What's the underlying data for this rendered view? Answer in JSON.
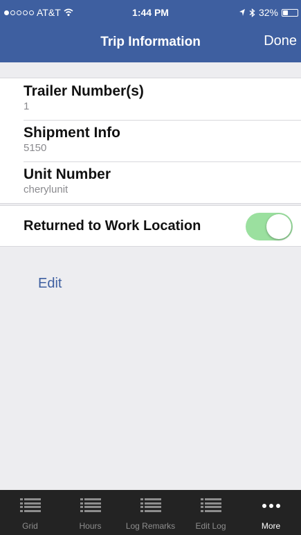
{
  "status_bar": {
    "carrier": "AT&T",
    "time": "1:44 PM",
    "battery_text": "32%",
    "battery_level": 0.32
  },
  "nav": {
    "title": "Trip Information",
    "done_label": "Done"
  },
  "fields": [
    {
      "label": "Trailer Number(s)",
      "value": "1"
    },
    {
      "label": "Shipment Info",
      "value": "5150"
    },
    {
      "label": "Unit Number",
      "value": "cherylunit"
    }
  ],
  "toggle": {
    "label": "Returned to Work Location",
    "on": true
  },
  "edit_label": "Edit",
  "tabs": [
    {
      "label": "Grid",
      "icon": "list-icon"
    },
    {
      "label": "Hours",
      "icon": "list-icon"
    },
    {
      "label": "Log Remarks",
      "icon": "list-icon"
    },
    {
      "label": "Edit Log",
      "icon": "list-icon"
    },
    {
      "label": "More",
      "icon": "more-icon",
      "active": true
    }
  ],
  "colors": {
    "header": "#3e5fa0",
    "toggle_on": "#9be09f",
    "tabbar": "#232323"
  }
}
